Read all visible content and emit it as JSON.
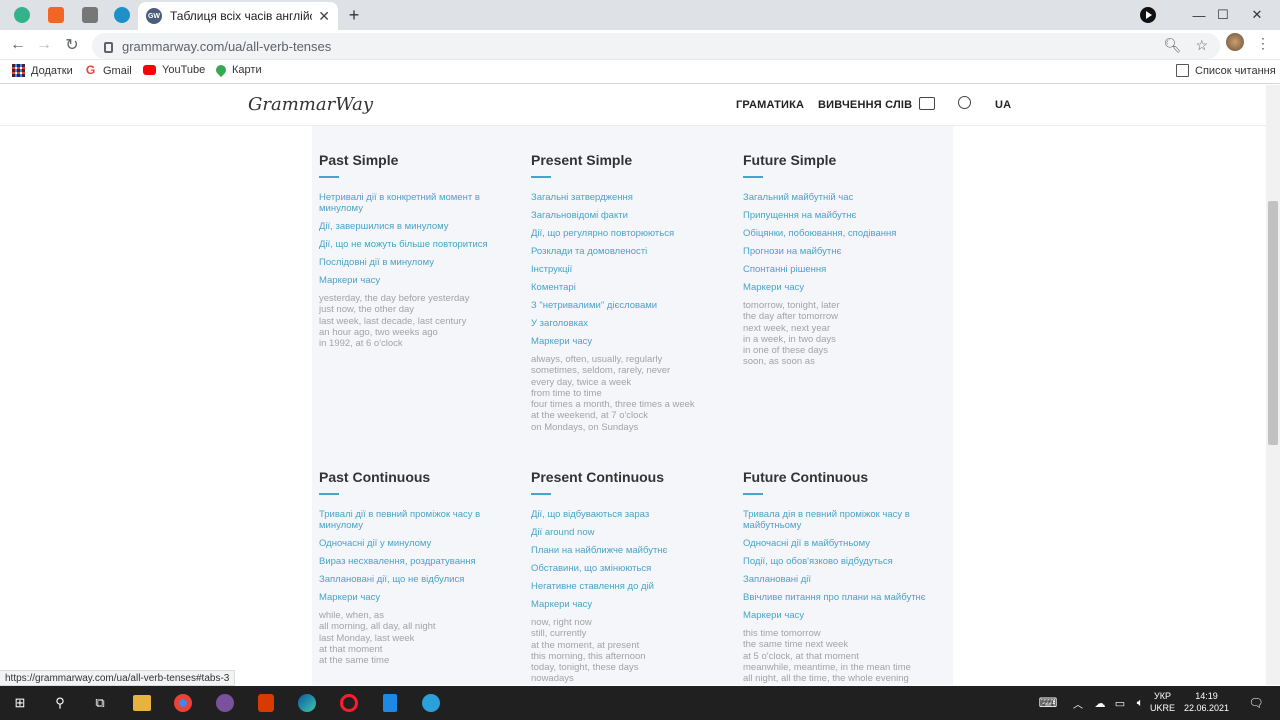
{
  "browser": {
    "tab_title": "Таблиця всіх часів англійської м",
    "favicon_text": "GW",
    "url": "grammarway.com/ua/all-verb-tenses",
    "status_url": "https://grammarway.com/ua/all-verb-tenses#tabs-3",
    "bookmarks": [
      {
        "label": "Додатки",
        "icon": "apps-grid-icon",
        "color": "#4285f4"
      },
      {
        "label": "Gmail",
        "icon": "google-g-icon",
        "color": "#ea4335"
      },
      {
        "label": "YouTube",
        "icon": "youtube-icon",
        "color": "#ff0000"
      },
      {
        "label": "Карти",
        "icon": "maps-pin-icon",
        "color": "#34a853"
      }
    ],
    "reading_list": "Список читання"
  },
  "site": {
    "logo": "GrammarWay",
    "nav": [
      "ГРАМАТИКА",
      "ВИВЧЕННЯ СЛІВ"
    ],
    "lang": "UA"
  },
  "sections": [
    {
      "title": "Past Simple",
      "links": [
        "Нетривалі дії в конкретний момент в минулому",
        "Дії, завершилися в минулому",
        "Дії, що не можуть більше повторитися",
        "Послідовні дії в минулому",
        "Маркери часу"
      ],
      "markers": [
        "yesterday, the day before yesterday",
        "just now, the other day",
        "last week, last decade, last century",
        "an hour ago, two weeks ago",
        "in 1992, at 6 o'clock"
      ]
    },
    {
      "title": "Present Simple",
      "links": [
        "Загальні затвердження",
        "Загальновідомі факти",
        "Дії, що регулярно повторюються",
        "Розклади та домовленості",
        "Інструкції",
        "Коментарі",
        "З \"нетривалими\" дієсловами",
        "У заголовках",
        "Маркери часу"
      ],
      "markers": [
        "always, often, usually, regularly",
        "sometimes, seldom, rarely, never",
        "every day, twice a week",
        "from time to time",
        "four times a month, three times a week",
        "at the weekend, at 7 o'clock",
        "on Mondays, on Sundays"
      ]
    },
    {
      "title": "Future Simple",
      "links": [
        "Загальний майбутній час",
        "Припущення на майбутнє",
        "Обіцянки, побоювання, сподівання",
        "Прогнози на майбутнє",
        "Спонтанні рішення",
        "Маркери часу"
      ],
      "markers": [
        "tomorrow, tonight, later",
        "the day after tomorrow",
        "next week, next year",
        "in a week, in two days",
        "in one of these days",
        "soon, as soon as"
      ]
    },
    {
      "title": "Past Continuous",
      "links": [
        "Тривалі дії в певний проміжок часу в минулому",
        "Одночасні дії у минулому",
        "Вираз несхвалення, роздратування",
        "Заплановані дії, що не відбулися",
        "Маркери часу"
      ],
      "markers": [
        "while, when, as",
        "all morning, all day, all night",
        "last Monday, last week",
        "at that moment",
        "at the same time"
      ]
    },
    {
      "title": "Present Continuous",
      "links": [
        "Дії, що відбуваються зараз",
        "Дії around now",
        "Плани на найближче майбутнє",
        "Обставини, що змінюються",
        "Негативне ставлення до дій",
        "Маркери часу"
      ],
      "markers": [
        "now, right now",
        "still, currently",
        "at the moment, at present",
        "this morning, this afternoon",
        "today, tonight, these days",
        "nowadays"
      ]
    },
    {
      "title": "Future Continuous",
      "links": [
        "Тривала дія в певний проміжок часу в майбутньому",
        "Одночасні дії в майбутньому",
        "Події, що обов'язково відбудуться",
        "Заплановані дії",
        "Ввічливе питання про плани на майбутнє",
        "Маркери часу"
      ],
      "markers": [
        "this time tomorrow",
        "the same time next week",
        "at 5 o'clock, at that moment",
        "meanwhile, meantime, in the mean time",
        "all night, all the time, the whole evening"
      ]
    }
  ],
  "system": {
    "lang_line1": "УКР",
    "lang_line2": "UKRE",
    "time": "14:19",
    "date": "22.06.2021"
  }
}
